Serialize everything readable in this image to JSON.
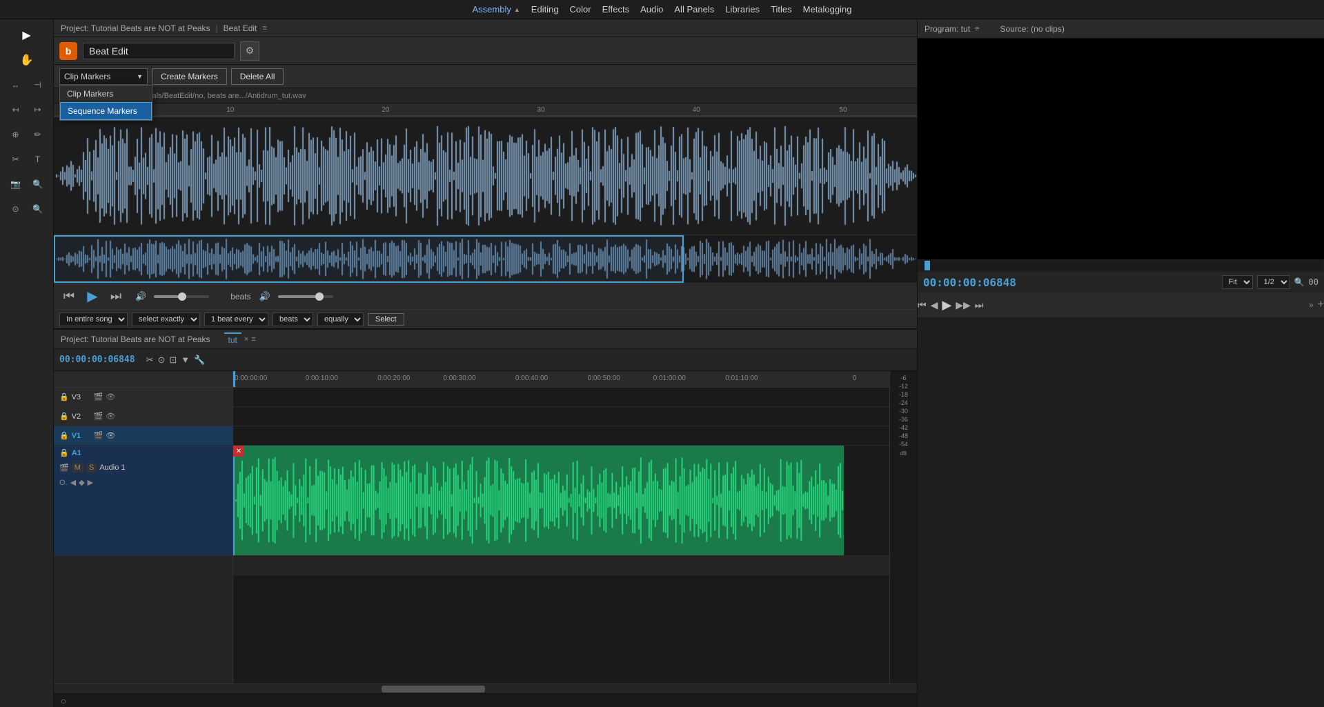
{
  "topmenu": {
    "items": [
      {
        "label": "Assembly",
        "active": true,
        "has_arrow": true
      },
      {
        "label": "Editing",
        "active": false,
        "has_arrow": false
      },
      {
        "label": "Color",
        "active": false,
        "has_arrow": false
      },
      {
        "label": "Effects",
        "active": false,
        "has_arrow": false
      },
      {
        "label": "Audio",
        "active": false,
        "has_arrow": false
      },
      {
        "label": "All Panels",
        "active": false,
        "has_arrow": false
      },
      {
        "label": "Libraries",
        "active": false,
        "has_arrow": false
      },
      {
        "label": "Titles",
        "active": false,
        "has_arrow": false
      },
      {
        "label": "Metalogging",
        "active": false,
        "has_arrow": false
      }
    ]
  },
  "project": {
    "title": "Project: Tutorial Beats are NOT at Peaks",
    "beat_edit_label": "Beat Edit",
    "menu_icon": "≡"
  },
  "beat_edit": {
    "logo_letter": "b",
    "title": "Beat Edit",
    "gear_icon": "⚙",
    "marker_type": "Clip Markers",
    "marker_type_arrow": "▼",
    "create_markers_btn": "Create Markers",
    "delete_all_btn": "Delete All",
    "dropdown_options": [
      "Clip Markers",
      "Sequence Markers"
    ],
    "filepath": "/rs/mmohl/Documents/tutorials/BeatEdit/no, beats are.../Antidrum_tut.wav",
    "ruler_ticks": [
      {
        "pos": "0%",
        "label": "0"
      },
      {
        "pos": "20%",
        "label": "10"
      },
      {
        "pos": "38%",
        "label": "20"
      },
      {
        "pos": "56%",
        "label": "30"
      },
      {
        "pos": "73%",
        "label": "40"
      },
      {
        "pos": "91%",
        "label": "50"
      }
    ]
  },
  "playback": {
    "rewind_icon": "⏮",
    "play_icon": "▶",
    "fastforward_icon": "⏭",
    "volume_icon": "🔊",
    "volume_pct": 45,
    "beats_label": "beats",
    "beats_volume_icon": "🔊",
    "beats_volume_pct": 70
  },
  "bottom_controls": {
    "option1": "In entire song",
    "option2": "select exactly",
    "option3": "1 beat every",
    "option4": "beats",
    "option5": "equally",
    "select_btn": "Select"
  },
  "timeline": {
    "project_label": "Project: Tutorial Beats are NOT at Peaks",
    "tab_label": "tut",
    "tab_menu": "≡",
    "timecode": "00:00:00:06848",
    "close_icon": "×",
    "tools": {
      "selection_tool": "▶",
      "track_select": "◉",
      "ripple_edit": "⊣",
      "rolling_edit": "⊢",
      "rate_stretch": "↔",
      "razor": "✂",
      "slip": "↕",
      "slide": "↕"
    },
    "ruler_labels": [
      {
        "label": "0:00:00:00",
        "pct": 0
      },
      {
        "label": "0:00:10:00",
        "pct": 11
      },
      {
        "label": "0:00:20:00",
        "pct": 22
      },
      {
        "label": "0:00:30:00",
        "pct": 32
      },
      {
        "label": "0:00:40:00",
        "pct": 43
      },
      {
        "label": "0:00:50:00",
        "pct": 54
      },
      {
        "label": "0:01:00:00",
        "pct": 64
      },
      {
        "label": "0:01:10:00",
        "pct": 75
      },
      {
        "label": "0",
        "pct": 95
      }
    ],
    "tracks": [
      {
        "id": "V3",
        "type": "video",
        "lock": true,
        "icons": [
          "🎬",
          "👁"
        ]
      },
      {
        "id": "V2",
        "type": "video",
        "lock": true,
        "icons": [
          "🎬",
          "👁"
        ]
      },
      {
        "id": "V1",
        "type": "video-active",
        "lock": true,
        "icons": [
          "🎬",
          "👁"
        ]
      },
      {
        "id": "A1",
        "type": "audio",
        "label": "Audio 1",
        "lock": true,
        "has_m": true,
        "has_s": true
      }
    ]
  },
  "program_monitor": {
    "title": "Program: tut",
    "title_menu": "≡",
    "source_title": "Source: (no clips)",
    "timecode": "00:00:00:06848",
    "fit_label": "Fit",
    "ratio_label": "1/2",
    "zoom_icon": "🔍",
    "zoom_value": "00",
    "ctrl_icons": {
      "step_back": "⏮",
      "step_back2": "◀",
      "play": "▶",
      "step_fwd": "▶▶",
      "step_fwd2": "⏭",
      "more": "»",
      "plus": "+"
    }
  },
  "vu_meter": {
    "labels": [
      "-6",
      "-12",
      "-18",
      "-24",
      "-30",
      "-36",
      "-42",
      "-48",
      "-54",
      "dB"
    ]
  },
  "status_bar": {
    "icon": "○"
  }
}
